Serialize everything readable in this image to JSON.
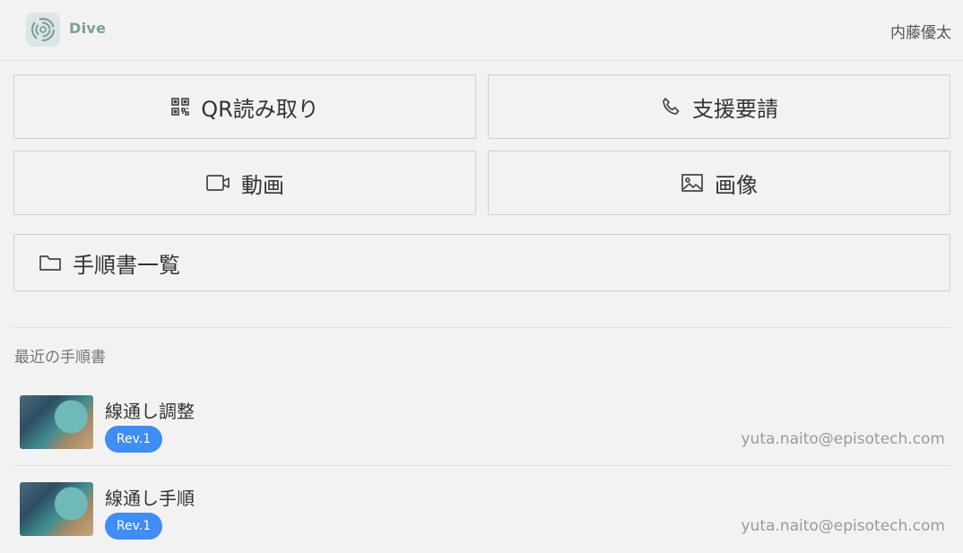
{
  "header": {
    "app_name": "Dive",
    "user_name": "内藤優太"
  },
  "actions": {
    "qr_label": "QR読み取り",
    "support_label": "支援要請",
    "video_label": "動画",
    "image_label": "画像",
    "list_label": "手順書一覧"
  },
  "recent": {
    "title": "最近の手順書",
    "items": [
      {
        "title": "線通し調整",
        "revision": "Rev.1",
        "author": "yuta.naito@episotech.com"
      },
      {
        "title": "線通し手順",
        "revision": "Rev.1",
        "author": "yuta.naito@episotech.com"
      }
    ]
  },
  "colors": {
    "background": "#f3f2f2",
    "badge": "#3f8df5",
    "logo_accent": "#7a9ea0"
  },
  "icons": {
    "logo": "swirl-logo-icon",
    "qr": "qr-code-icon",
    "support": "phone-icon",
    "video": "video-camera-icon",
    "image": "image-icon",
    "list": "folder-icon"
  }
}
